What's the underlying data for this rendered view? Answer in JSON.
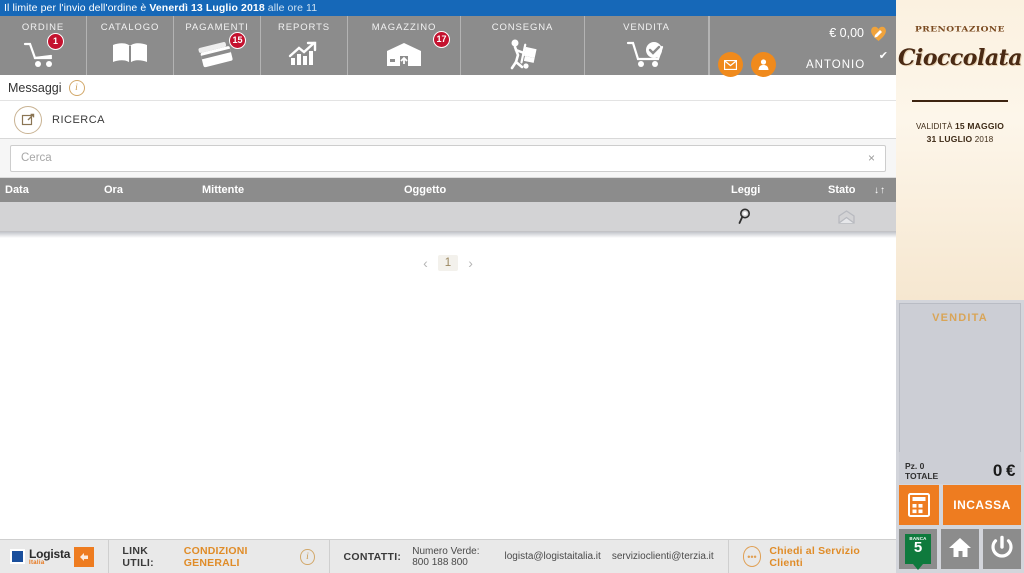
{
  "deadline": {
    "prefix": "Il limite per l'invio dell'ordine è ",
    "highlight": "Venerdì 13 Luglio 2018",
    "suffix": " alle ore 11"
  },
  "nav": {
    "items": [
      {
        "label": "ORDINE",
        "icon": "cart-alert-icon",
        "badge": "1"
      },
      {
        "label": "CATALOGO",
        "icon": "book-icon",
        "badge": ""
      },
      {
        "label": "PAGAMENTI",
        "icon": "credit-card-icon",
        "badge": "15"
      },
      {
        "label": "REPORTS",
        "icon": "chart-arrow-icon",
        "badge": ""
      },
      {
        "label": "MAGAZZINO",
        "icon": "warehouse-icon",
        "badge": "17"
      },
      {
        "label": "CONSEGNA",
        "icon": "delivery-icon",
        "badge": ""
      },
      {
        "label": "VENDITA",
        "icon": "cart-check-icon",
        "badge": ""
      }
    ]
  },
  "user": {
    "wallet_amount": "€ 0,00",
    "wallet_icon": "heart-pen-icon",
    "mail_icon": "envelope-icon",
    "profile_icon": "user-icon",
    "name": "ANTONIO",
    "status_check": "✔"
  },
  "page": {
    "title": "Messaggi",
    "info_icon": "info-icon",
    "ricerca_label": "RICERCA",
    "ricerca_icon": "edit-square-icon"
  },
  "search": {
    "value": "",
    "placeholder": "Cerca",
    "clear_icon": "×"
  },
  "table": {
    "columns": [
      "Data",
      "Ora",
      "Mittente",
      "Oggetto",
      "Leggi",
      "Stato"
    ],
    "sort_icon": "↓↑",
    "rows": [
      {
        "data": "",
        "ora": "",
        "mittente": "",
        "oggetto": "",
        "leggi_icon": "magnifier-icon",
        "stato_icon": "envelope-open-icon"
      }
    ]
  },
  "pagination": {
    "prev": "‹",
    "page": "1",
    "next": "›"
  },
  "footer": {
    "brand_name": "Logista",
    "brand_sub": "Italia",
    "links_label": "LINK UTILI:",
    "links_value": "CONDIZIONI GENERALI",
    "links_info_icon": "info-icon",
    "contacts_label": "CONTATTI:",
    "contacts_phone": "Numero Verde: 800 188 800",
    "contacts_email1": "logista@logistaitalia.it",
    "contacts_email2": "servizioclienti@terzia.it",
    "support_icon": "chat-bubble-icon",
    "support_label": "Chiedi al Servizio Clienti"
  },
  "sidebar": {
    "promo": {
      "kicker": "PRENOTAZIONE",
      "title": "Cioccolata",
      "validity_label": "VALIDITÀ ",
      "validity_from": "15 MAGGIO",
      "validity_to": "31 LUGLIO",
      "validity_year": " 2018"
    },
    "vendita": {
      "header": "VENDITA",
      "pieces_label": "Pz. 0",
      "total_label": "TOTALE",
      "total_value": "0 €",
      "calc_icon": "calculator-icon",
      "incassa_label": "INCASSA"
    },
    "bottom": {
      "banca_top": "BANCA",
      "banca_num": "5",
      "home_icon": "home-icon",
      "power_icon": "power-icon"
    }
  },
  "colors": {
    "banner_blue": "#1668b8",
    "nav_gray": "#8c8c8c",
    "accent_orange": "#ee7c20",
    "badge_red": "#c4122f",
    "gold": "#d9a558"
  }
}
